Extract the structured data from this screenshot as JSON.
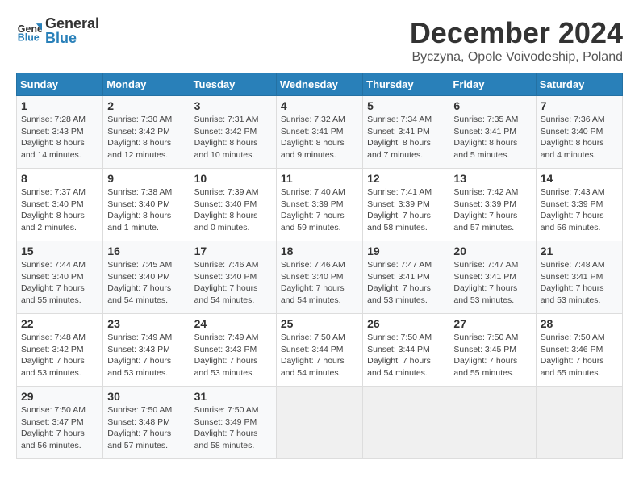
{
  "header": {
    "logo_line1": "General",
    "logo_line2": "Blue",
    "title": "December 2024",
    "location": "Byczyna, Opole Voivodeship, Poland"
  },
  "calendar": {
    "days_of_week": [
      "Sunday",
      "Monday",
      "Tuesday",
      "Wednesday",
      "Thursday",
      "Friday",
      "Saturday"
    ],
    "weeks": [
      [
        {
          "day": "1",
          "sunrise": "7:28 AM",
          "sunset": "3:43 PM",
          "daylight": "8 hours and 14 minutes."
        },
        {
          "day": "2",
          "sunrise": "7:30 AM",
          "sunset": "3:42 PM",
          "daylight": "8 hours and 12 minutes."
        },
        {
          "day": "3",
          "sunrise": "7:31 AM",
          "sunset": "3:42 PM",
          "daylight": "8 hours and 10 minutes."
        },
        {
          "day": "4",
          "sunrise": "7:32 AM",
          "sunset": "3:41 PM",
          "daylight": "8 hours and 9 minutes."
        },
        {
          "day": "5",
          "sunrise": "7:34 AM",
          "sunset": "3:41 PM",
          "daylight": "8 hours and 7 minutes."
        },
        {
          "day": "6",
          "sunrise": "7:35 AM",
          "sunset": "3:41 PM",
          "daylight": "8 hours and 5 minutes."
        },
        {
          "day": "7",
          "sunrise": "7:36 AM",
          "sunset": "3:40 PM",
          "daylight": "8 hours and 4 minutes."
        }
      ],
      [
        {
          "day": "8",
          "sunrise": "7:37 AM",
          "sunset": "3:40 PM",
          "daylight": "8 hours and 2 minutes."
        },
        {
          "day": "9",
          "sunrise": "7:38 AM",
          "sunset": "3:40 PM",
          "daylight": "8 hours and 1 minute."
        },
        {
          "day": "10",
          "sunrise": "7:39 AM",
          "sunset": "3:40 PM",
          "daylight": "8 hours and 0 minutes."
        },
        {
          "day": "11",
          "sunrise": "7:40 AM",
          "sunset": "3:39 PM",
          "daylight": "7 hours and 59 minutes."
        },
        {
          "day": "12",
          "sunrise": "7:41 AM",
          "sunset": "3:39 PM",
          "daylight": "7 hours and 58 minutes."
        },
        {
          "day": "13",
          "sunrise": "7:42 AM",
          "sunset": "3:39 PM",
          "daylight": "7 hours and 57 minutes."
        },
        {
          "day": "14",
          "sunrise": "7:43 AM",
          "sunset": "3:39 PM",
          "daylight": "7 hours and 56 minutes."
        }
      ],
      [
        {
          "day": "15",
          "sunrise": "7:44 AM",
          "sunset": "3:40 PM",
          "daylight": "7 hours and 55 minutes."
        },
        {
          "day": "16",
          "sunrise": "7:45 AM",
          "sunset": "3:40 PM",
          "daylight": "7 hours and 54 minutes."
        },
        {
          "day": "17",
          "sunrise": "7:46 AM",
          "sunset": "3:40 PM",
          "daylight": "7 hours and 54 minutes."
        },
        {
          "day": "18",
          "sunrise": "7:46 AM",
          "sunset": "3:40 PM",
          "daylight": "7 hours and 54 minutes."
        },
        {
          "day": "19",
          "sunrise": "7:47 AM",
          "sunset": "3:41 PM",
          "daylight": "7 hours and 53 minutes."
        },
        {
          "day": "20",
          "sunrise": "7:47 AM",
          "sunset": "3:41 PM",
          "daylight": "7 hours and 53 minutes."
        },
        {
          "day": "21",
          "sunrise": "7:48 AM",
          "sunset": "3:41 PM",
          "daylight": "7 hours and 53 minutes."
        }
      ],
      [
        {
          "day": "22",
          "sunrise": "7:48 AM",
          "sunset": "3:42 PM",
          "daylight": "7 hours and 53 minutes."
        },
        {
          "day": "23",
          "sunrise": "7:49 AM",
          "sunset": "3:43 PM",
          "daylight": "7 hours and 53 minutes."
        },
        {
          "day": "24",
          "sunrise": "7:49 AM",
          "sunset": "3:43 PM",
          "daylight": "7 hours and 53 minutes."
        },
        {
          "day": "25",
          "sunrise": "7:50 AM",
          "sunset": "3:44 PM",
          "daylight": "7 hours and 54 minutes."
        },
        {
          "day": "26",
          "sunrise": "7:50 AM",
          "sunset": "3:44 PM",
          "daylight": "7 hours and 54 minutes."
        },
        {
          "day": "27",
          "sunrise": "7:50 AM",
          "sunset": "3:45 PM",
          "daylight": "7 hours and 55 minutes."
        },
        {
          "day": "28",
          "sunrise": "7:50 AM",
          "sunset": "3:46 PM",
          "daylight": "7 hours and 55 minutes."
        }
      ],
      [
        {
          "day": "29",
          "sunrise": "7:50 AM",
          "sunset": "3:47 PM",
          "daylight": "7 hours and 56 minutes."
        },
        {
          "day": "30",
          "sunrise": "7:50 AM",
          "sunset": "3:48 PM",
          "daylight": "7 hours and 57 minutes."
        },
        {
          "day": "31",
          "sunrise": "7:50 AM",
          "sunset": "3:49 PM",
          "daylight": "7 hours and 58 minutes."
        },
        null,
        null,
        null,
        null
      ]
    ]
  }
}
